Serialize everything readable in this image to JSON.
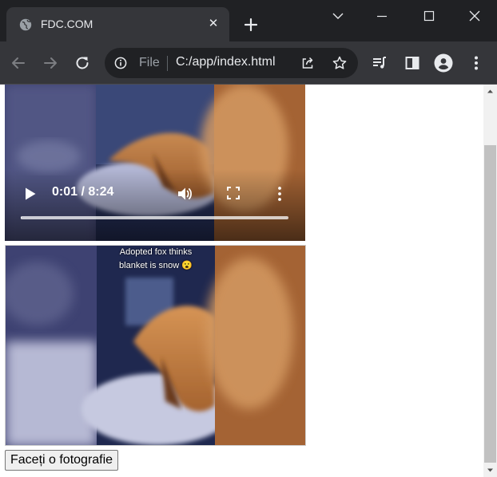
{
  "browser": {
    "tab": {
      "title": "FDC.COM",
      "close": "✕"
    },
    "omnibox": {
      "scheme": "File",
      "url": "C:/app/index.html"
    },
    "icons": {
      "favicon": "globe-icon",
      "new_tab": "plus-icon",
      "tab_search": "chevron-down-icon",
      "minimize": "minimize-icon",
      "maximize": "maximize-icon",
      "close_window": "close-icon",
      "back": "arrow-left-icon",
      "forward": "arrow-right-icon",
      "reload": "reload-icon",
      "info": "info-icon",
      "share": "share-icon",
      "bookmark": "star-icon",
      "media": "media-queue-icon",
      "side_panel": "side-panel-icon",
      "profile": "person-icon",
      "menu": "more-vert-icon"
    },
    "colors": {
      "frame": "#202124",
      "toolbar": "#35363a",
      "omnibox": "#202124",
      "text": "#e8eaed"
    }
  },
  "page": {
    "video": {
      "time": "0:01 / 8:24",
      "progress": 0.002,
      "icons": {
        "play": "play-icon",
        "volume": "volume-icon",
        "fullscreen": "fullscreen-icon",
        "more": "more-vert-icon"
      }
    },
    "photo": {
      "caption_line1": "Adopted fox thinks",
      "caption_line2": "blanket is snow 😮"
    },
    "button_label": "Faceți o fotografie"
  },
  "scrollbar": {
    "position": 0.15,
    "icons": {
      "up": "scroll-up-icon",
      "down": "scroll-down-icon"
    }
  }
}
